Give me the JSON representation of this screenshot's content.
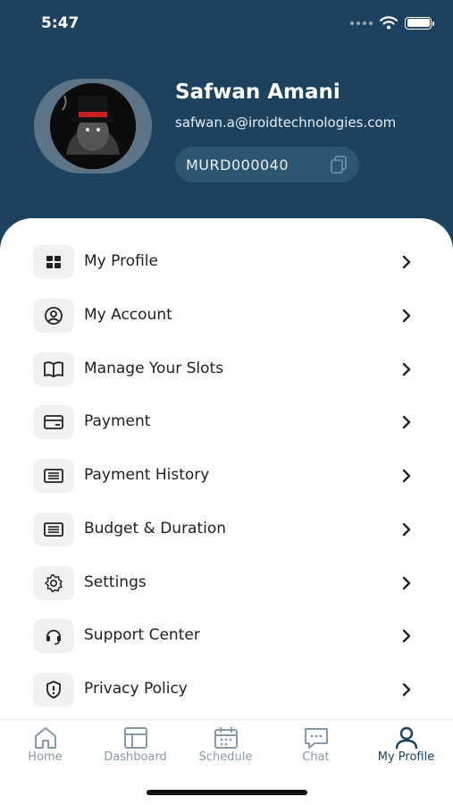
{
  "status": {
    "time": "5:47"
  },
  "profile": {
    "name": "Safwan Amani",
    "email": "safwan.a@iroidtechnologies.com",
    "member_id": "MURD000040"
  },
  "menu": [
    {
      "label": "My Profile",
      "icon": "grid-icon"
    },
    {
      "label": "My Account",
      "icon": "user-circle-icon"
    },
    {
      "label": "Manage Your Slots",
      "icon": "book-icon"
    },
    {
      "label": "Payment",
      "icon": "card-icon"
    },
    {
      "label": "Payment History",
      "icon": "list-card-icon"
    },
    {
      "label": "Budget & Duration",
      "icon": "list-card-icon"
    },
    {
      "label": "Settings",
      "icon": "gear-icon"
    },
    {
      "label": "Support Center",
      "icon": "headset-icon"
    },
    {
      "label": "Privacy Policy",
      "icon": "shield-icon"
    }
  ],
  "tabs": [
    {
      "label": "Home",
      "icon": "home-icon",
      "active": false
    },
    {
      "label": "Dashboard",
      "icon": "dashboard-icon",
      "active": false
    },
    {
      "label": "Schedule",
      "icon": "calendar-icon",
      "active": false
    },
    {
      "label": "Chat",
      "icon": "chat-icon",
      "active": false
    },
    {
      "label": "My Profile",
      "icon": "person-icon",
      "active": true
    }
  ],
  "colors": {
    "header_bg": "#1c4260",
    "active_tab": "#1c4260",
    "inactive_tab": "#8799a6"
  }
}
